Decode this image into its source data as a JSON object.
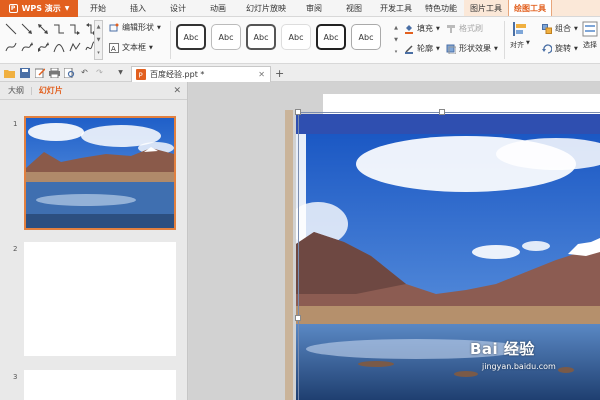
{
  "app": {
    "name": "WPS 演示",
    "logo_glyph": "P"
  },
  "menu_tabs": [
    "开始",
    "插入",
    "设计",
    "动画",
    "幻灯片放映",
    "审阅",
    "视图",
    "开发工具",
    "特色功能"
  ],
  "context_tabs": {
    "picture_tools": "图片工具",
    "drawing_tools": "绘图工具"
  },
  "ribbon": {
    "edit_shape": "编辑形状",
    "text_box": "文本框",
    "style_sample": "Abc",
    "fill": "填充",
    "format_painter": "格式刷",
    "outline": "轮廓",
    "shape_effect": "形状效果",
    "align": "对齐",
    "group": "组合",
    "rotate": "旋转",
    "selection_pane": "选择"
  },
  "doc_tab": {
    "title": "百度经验.ppt *"
  },
  "left_panel": {
    "outline_tab": "大纲",
    "slides_tab": "幻灯片"
  },
  "slides": [
    {
      "number": "1",
      "selected": true
    },
    {
      "number": "2",
      "selected": false
    },
    {
      "number": "3",
      "selected": false
    }
  ],
  "watermark": {
    "logo": "Bai 经验",
    "url": "jingyan.baidu.com"
  },
  "colors": {
    "accent": "#e2601f",
    "context_tab": "#fbe8d8",
    "selection_border": "#7a8db0"
  }
}
